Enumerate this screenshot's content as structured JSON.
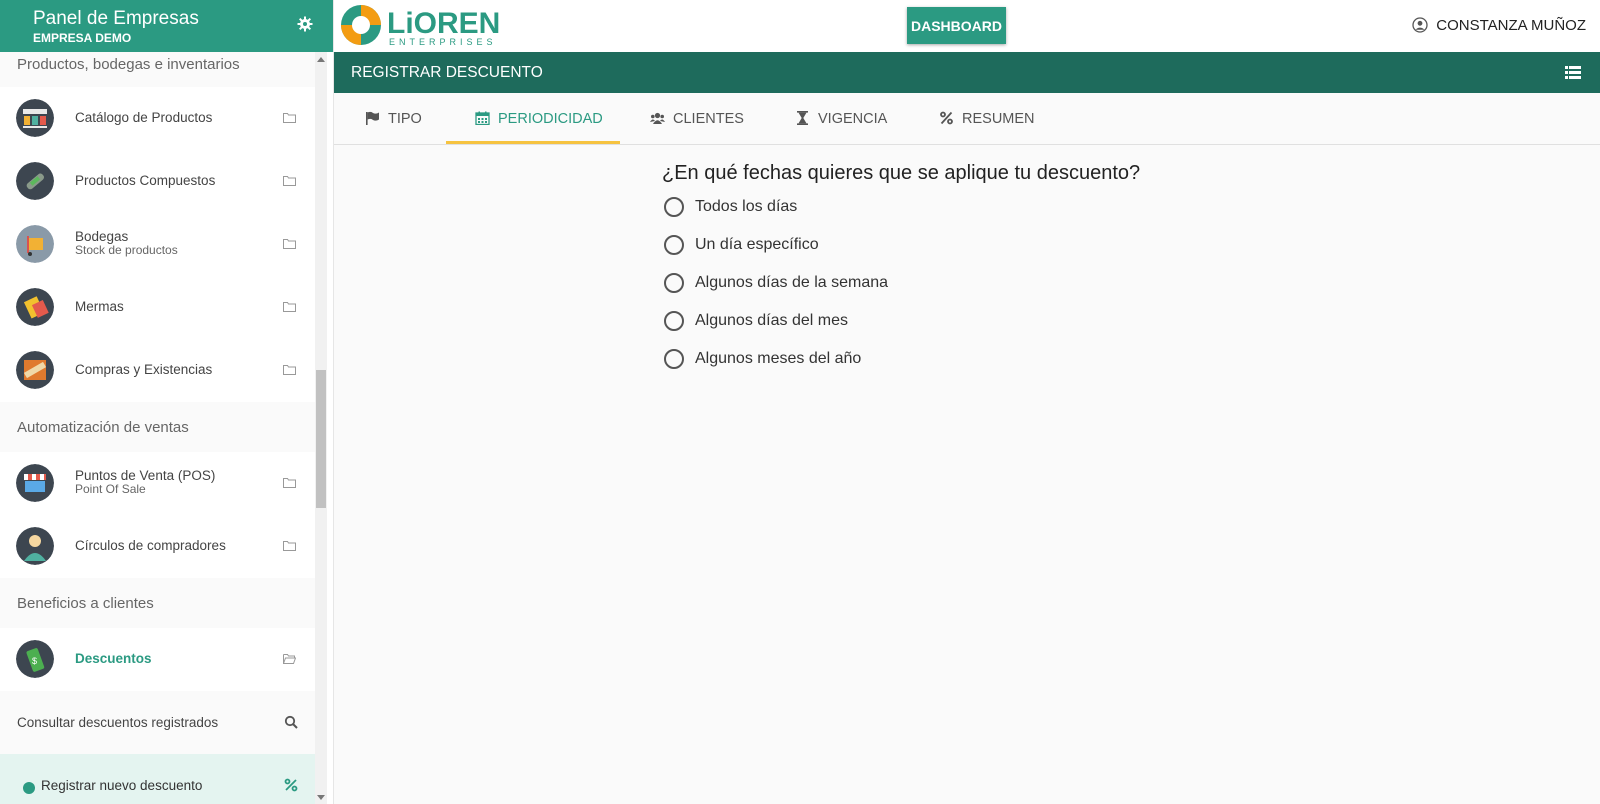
{
  "sidebar": {
    "title": "Panel de Empresas",
    "subtitle": "EMPRESA DEMO",
    "sections": [
      {
        "title": "Productos, bodegas e inventarios"
      },
      {
        "title": "Automatización de ventas"
      },
      {
        "title": "Beneficios a clientes"
      }
    ],
    "items": [
      {
        "label": "Catálogo de Productos"
      },
      {
        "label": "Productos Compuestos"
      },
      {
        "label": "Bodegas",
        "sublabel": "Stock de productos"
      },
      {
        "label": "Mermas"
      },
      {
        "label": "Compras y Existencias"
      },
      {
        "label": "Puntos de Venta (POS)",
        "sublabel": "Point Of Sale"
      },
      {
        "label": "Círculos de compradores"
      },
      {
        "label": "Descuentos"
      }
    ],
    "subitems": [
      {
        "label": "Consultar descuentos registrados",
        "icon": "search-icon"
      },
      {
        "label": "Registrar nuevo descuento",
        "icon": "percent-icon"
      }
    ]
  },
  "topbar": {
    "logo_text": "LiOREN",
    "logo_sub": "ENTERPRISES",
    "dashboard_label": "DASHBOARD",
    "user_name": "CONSTANZA MUÑOZ"
  },
  "page": {
    "title": "REGISTRAR DESCUENTO",
    "tabs": [
      {
        "label": "TIPO",
        "icon": "flag-icon"
      },
      {
        "label": "PERIODICIDAD",
        "icon": "calendar-icon",
        "active": true
      },
      {
        "label": "CLIENTES",
        "icon": "users-icon"
      },
      {
        "label": "VIGENCIA",
        "icon": "hourglass-icon"
      },
      {
        "label": "RESUMEN",
        "icon": "percent-icon"
      }
    ],
    "question": "¿En qué fechas quieres que se aplique tu descuento?",
    "options": [
      "Todos los días",
      "Un día específico",
      "Algunos días de la semana",
      "Algunos días del mes",
      "Algunos meses del año"
    ]
  },
  "colors": {
    "primary": "#2b9a82",
    "dark": "#1e6b5c",
    "accent": "#f6c340"
  }
}
